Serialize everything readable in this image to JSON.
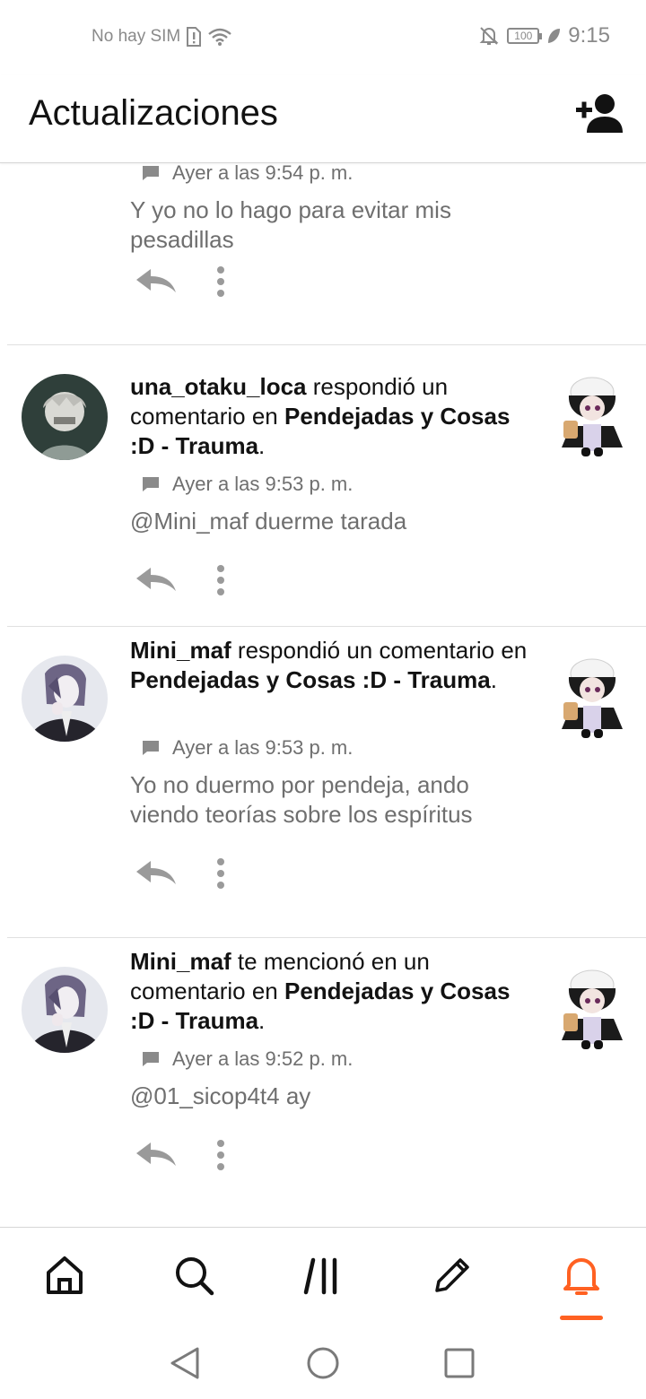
{
  "status_bar": {
    "carrier": "No hay SIM",
    "battery": "100",
    "time": "9:15",
    "icons": [
      "sim-alert-icon",
      "wifi-icon",
      "bell-muted-icon",
      "battery-icon",
      "leaf-icon"
    ]
  },
  "header": {
    "title": "Actualizaciones",
    "add_user_icon": "add-user-icon"
  },
  "notifications": [
    {
      "meta": "Ayer a las 9:54 p. m.",
      "comment": "Y yo no lo hago para evitar mis pesadillas"
    },
    {
      "user": "una_otaku_loca",
      "action": " respondió un comentario en ",
      "story": "Pendejadas y Cosas :D - Trauma",
      "end": ".",
      "meta": "Ayer a las 9:53 p. m.",
      "comment": "@Mini_maf duerme tarada"
    },
    {
      "user": "Mini_maf",
      "action": " respondió un comentario en ",
      "story": "Pendejadas y Cosas :D - Trauma",
      "end": ".",
      "meta": "Ayer a las 9:53 p. m.",
      "comment": "Yo no duermo por pendeja, ando viendo teorías sobre los espíritus"
    },
    {
      "user": "Mini_maf",
      "action": " te mencionó en un comentario en ",
      "story": "Pendejadas y Cosas :D - Trauma",
      "end": ".",
      "meta": "Ayer a las 9:52 p. m.",
      "comment": "@01_sicop4t4 ay"
    }
  ],
  "tab_bar": {
    "tabs": [
      "home-icon",
      "search-icon",
      "library-icon",
      "write-icon",
      "notifications-bell-icon"
    ],
    "active_tab": "notifications-bell-icon"
  },
  "nav_bar": {
    "buttons": [
      "back-triangle-icon",
      "home-circle-icon",
      "recents-square-icon"
    ]
  },
  "colors": {
    "accent": "#ff6122",
    "text_primary": "#121212",
    "text_secondary": "#6f6f6f",
    "divider": "#e0e0e0"
  }
}
